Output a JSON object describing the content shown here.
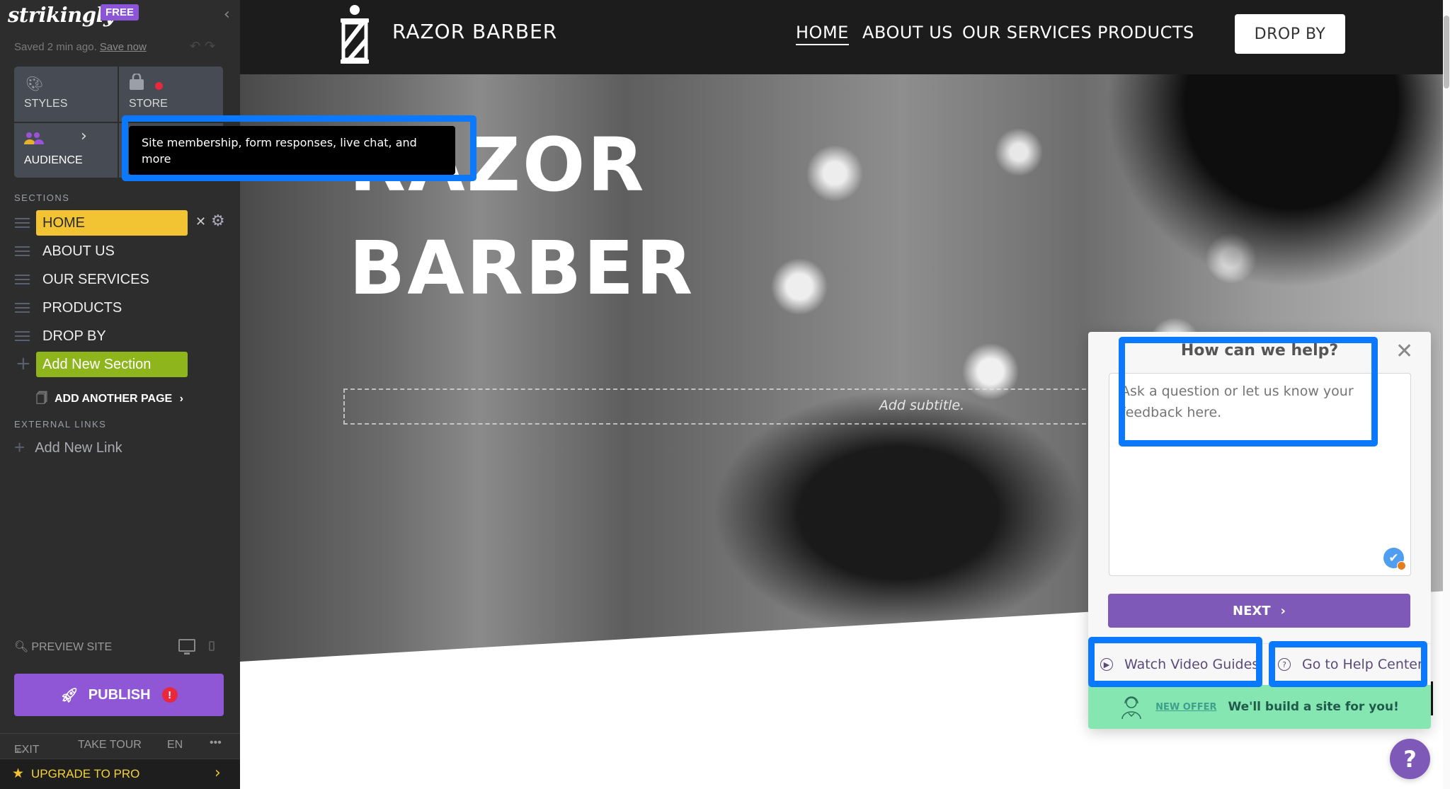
{
  "editor": {
    "logo": "strikingly",
    "plan_badge": "FREE",
    "saved_status": "Saved 2 min ago.",
    "save_now": "Save now",
    "tiles": [
      {
        "label": "STYLES",
        "icon": "palette-icon"
      },
      {
        "label": "STORE",
        "icon": "shopping-bag-icon",
        "notification": true
      },
      {
        "label": "AUDIENCE",
        "icon": "people-icon"
      }
    ],
    "tooltip": "Site membership, form responses, live chat, and more",
    "sections_heading": "SECTIONS",
    "sections": [
      {
        "label": "HOME",
        "active": true
      },
      {
        "label": "ABOUT US"
      },
      {
        "label": "OUR SERVICES"
      },
      {
        "label": "PRODUCTS"
      },
      {
        "label": "DROP BY"
      }
    ],
    "add_section": "Add New Section",
    "add_page": "ADD ANOTHER PAGE",
    "external_links_heading": "EXTERNAL LINKS",
    "add_link": "Add New Link",
    "preview": "PREVIEW SITE",
    "publish": "PUBLISH",
    "footer": {
      "exit": "EXIT",
      "tour": "TAKE TOUR",
      "lang": "EN",
      "more": "•••"
    },
    "upgrade": "UPGRADE TO PRO"
  },
  "site": {
    "brand": "RAZOR BARBER",
    "nav": [
      "HOME",
      "ABOUT US",
      "OUR SERVICES",
      "PRODUCTS"
    ],
    "nav_active": "HOME",
    "cta": "DROP BY",
    "hero_title_line1": "RAZOR",
    "hero_title_line2": "BARBER",
    "subtitle_placeholder": "Add subtitle."
  },
  "help": {
    "title": "How can we help?",
    "textarea_placeholder": "Ask a question or let us know your feedback here.",
    "next": "NEXT",
    "watch_videos": "Watch Video Guides",
    "help_center": "Go to Help Center",
    "offer_tag": "NEW OFFER",
    "offer_text": "We'll build a site for you!",
    "fab": "?"
  },
  "colors": {
    "highlight": "#0a78ff",
    "accent_purple": "#8f57d6",
    "active_section": "#f2c434",
    "add_section": "#8fb51d",
    "offer_green": "#86e6b1"
  }
}
